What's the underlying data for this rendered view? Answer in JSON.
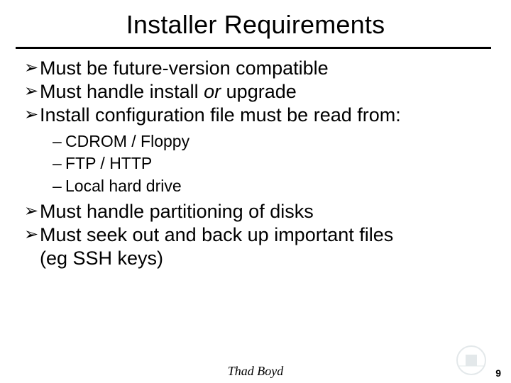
{
  "title": "Installer Requirements",
  "bullets": [
    {
      "text": "Must be future-version compatible"
    },
    {
      "pre": "Must handle install ",
      "em": "or",
      "post": " upgrade"
    },
    {
      "text": "Install configuration file must be read from:",
      "sub": [
        "CDROM / Floppy",
        "FTP / HTTP",
        "Local hard drive"
      ]
    },
    {
      "text": "Must handle partitioning of disks"
    },
    {
      "text": "Must seek out and back up important files",
      "cont": "(eg SSH keys)"
    }
  ],
  "footer": {
    "author": "Thad Boyd",
    "page": "9"
  }
}
